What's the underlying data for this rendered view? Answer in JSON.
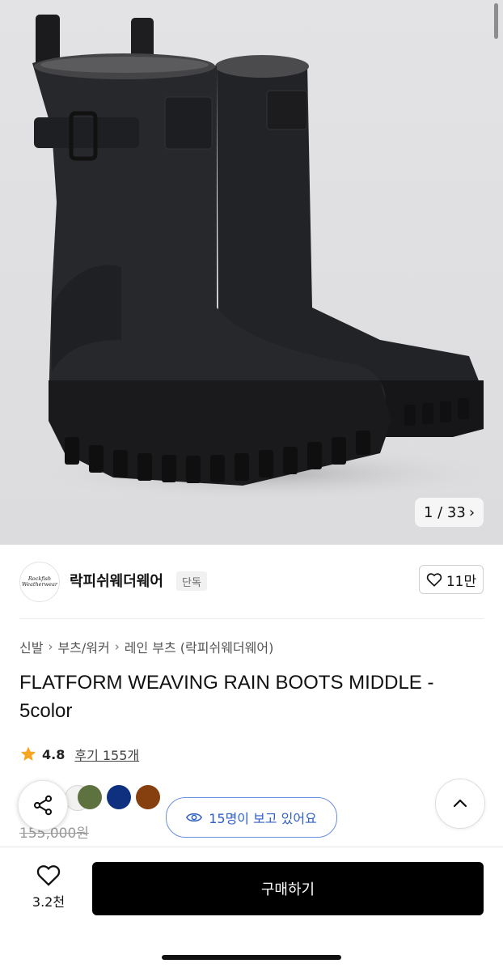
{
  "gallery": {
    "current": "1",
    "separator": "/",
    "total": "33",
    "counter_label": "1 / 33"
  },
  "brand": {
    "logo_line1": "Rockfish",
    "logo_line2": "Weatherwear",
    "name": "락피쉬웨더웨어",
    "badge": "단독",
    "likes": "11만"
  },
  "breadcrumb": [
    "신발",
    "부츠/워커",
    "레인 부츠 (락피쉬웨더웨어)"
  ],
  "product": {
    "title": "FLATFORM WEAVING RAIN BOOTS MIDDLE - 5color",
    "rating": "4.8",
    "reviews": "후기 155개",
    "original_price": "155,000원"
  },
  "swatches": [
    {
      "name": "white",
      "color": "#f2f2f0"
    },
    {
      "name": "olive",
      "color": "#5e7240"
    },
    {
      "name": "navy",
      "color": "#0f2f7f"
    },
    {
      "name": "brown",
      "color": "#86400f"
    }
  ],
  "viewers": {
    "text": "15명이 보고 있어요"
  },
  "bottom_bar": {
    "wish_count": "3.2천",
    "buy_label": "구매하기"
  },
  "colors": {
    "accent_blue": "#2f5fc8",
    "star": "#f5a623",
    "buy_button": "#000000"
  }
}
